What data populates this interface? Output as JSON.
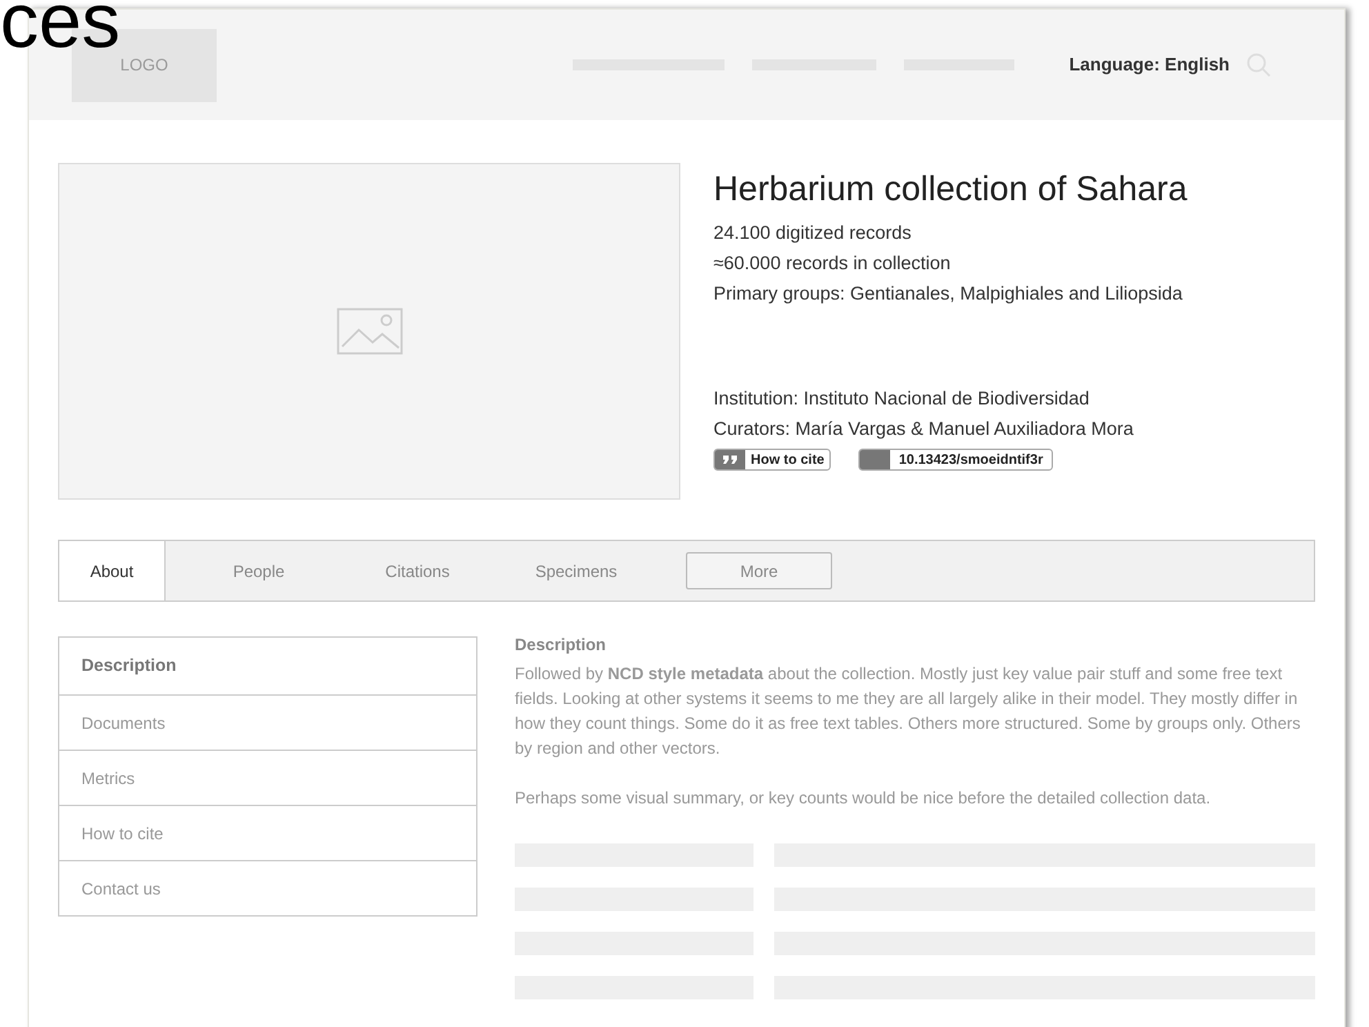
{
  "slide_title_fragment": "ces",
  "header": {
    "logo": "LOGO",
    "language": "Language: English"
  },
  "collection": {
    "title": "Herbarium collection of Sahara",
    "stats": [
      "24.100 digitized records",
      "≈60.000 records in collection",
      "Primary groups: Gentianales, Malpighiales and Liliopsida"
    ],
    "details": [
      "Institution: Instituto Nacional de Biodiversidad",
      "Curators: María Vargas & Manuel Auxiliadora Mora"
    ],
    "cite_badge": "How to cite",
    "doi_badge": "10.13423/smoeidntif3r"
  },
  "tabs": [
    {
      "label": "About",
      "selected": true
    },
    {
      "label": "People",
      "selected": false
    },
    {
      "label": "Citations",
      "selected": false
    },
    {
      "label": "Specimens",
      "selected": false
    }
  ],
  "more_button": "More",
  "sidebar": {
    "items": [
      {
        "label": "Description",
        "selected": true
      },
      {
        "label": "Documents",
        "selected": false
      },
      {
        "label": "Metrics",
        "selected": false
      },
      {
        "label": "How to cite",
        "selected": false
      },
      {
        "label": "Contact us",
        "selected": false
      }
    ]
  },
  "content": {
    "heading": "Description",
    "paragraphs": [
      "Followed by **NCD style metadata** about the collection. Mostly just key value pair stuff and some free text fields. Looking at other systems it seems to me they are all largely alike in their model. They mostly differ in how they count things. Some do it as free text tables. Others more structured. Some by groups only. Others by region and other vectors.",
      "Perhaps some visual summary, or key counts would be nice before the detailed collection data."
    ]
  }
}
